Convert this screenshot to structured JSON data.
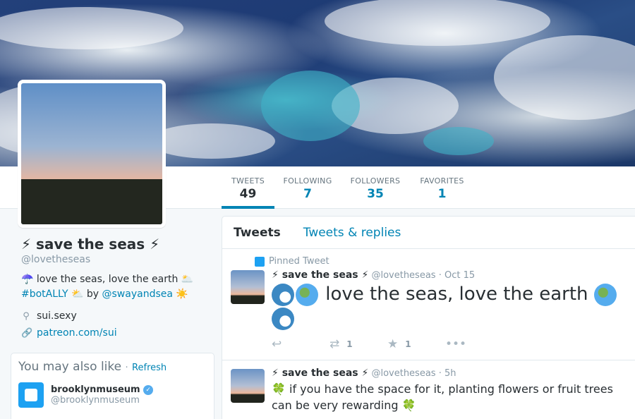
{
  "profile": {
    "name": "⚡ save the seas ⚡",
    "handle": "@lovetheseas",
    "bio_line1_emoji": "☂️",
    "bio_line1_text": "love the seas, love the earth",
    "bio_line1_emoji2": "🌥️",
    "bio_hashtag": "#botALLY",
    "bio_by": "by",
    "bio_emoji3": "⛅",
    "bio_mention": "@swayandsea",
    "bio_emoji4": "☀️",
    "location": "sui.sexy",
    "website": "patreon.com/sui"
  },
  "stats": [
    {
      "label": "TWEETS",
      "value": "49"
    },
    {
      "label": "FOLLOWING",
      "value": "7"
    },
    {
      "label": "FOLLOWERS",
      "value": "35"
    },
    {
      "label": "FAVORITES",
      "value": "1"
    }
  ],
  "tabs": {
    "tweets": "Tweets",
    "replies": "Tweets & replies"
  },
  "wtf": {
    "title": "You may also like",
    "dot": "·",
    "refresh": "Refresh",
    "user_name": "brooklynmuseum",
    "user_handle": "@brooklynmuseum"
  },
  "tweet1": {
    "pinned_label": "Pinned Tweet",
    "name": "⚡ save the seas ⚡",
    "handle": "@lovetheseas",
    "time": "· Oct 15",
    "text": "love the seas, love the earth",
    "retweets": "1",
    "likes": "1"
  },
  "tweet2": {
    "name": "⚡ save the seas ⚡",
    "handle": "@lovetheseas",
    "time": "· 5h",
    "emoji": "🍀",
    "text": "if you have the space for it, planting flowers or fruit trees can be very rewarding",
    "emoji_end": "🍀"
  },
  "colors": {
    "link": "#0084b4",
    "accent": "#1da1f2",
    "text": "#292f33",
    "muted": "#8899a6"
  },
  "icons": [
    "reply-icon",
    "retweet-icon",
    "star-icon",
    "more-icon",
    "location-pin-icon",
    "link-icon",
    "pin-icon",
    "verified-icon"
  ]
}
